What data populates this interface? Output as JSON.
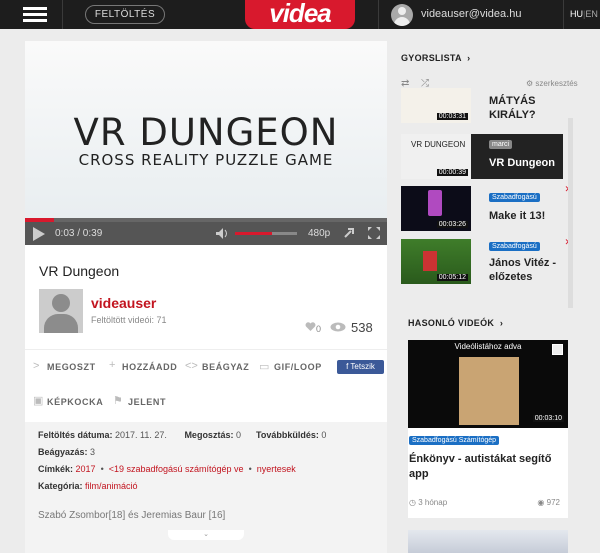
{
  "topbar": {
    "upload_label": "FELTÖLTÉS",
    "logo_text": "videa",
    "user_email": "videauser@videa.hu",
    "lang_active": "HU",
    "lang_other": "EN",
    "brand_color": "#d8192d"
  },
  "player": {
    "title_text": "VR DUNGEON",
    "subtitle_text": "CROSS REALITY PUZZLE GAME",
    "time": "0:03 / 0:39",
    "progress_fraction": 0.08,
    "volume_fraction": 0.6,
    "quality": "480p"
  },
  "video": {
    "name": "VR Dungeon",
    "uploader": "videauser",
    "uploaded_label": "Feltöltött videói:",
    "uploaded_count": "71",
    "likes": "0",
    "views": "538"
  },
  "actions": {
    "share": "MEGOSZT",
    "add": "HOZZÁADD",
    "embed": "BEÁGYAZ",
    "gif": "GIF/LOOP",
    "like": "Tetszik",
    "frame": "KÉPKOCKA",
    "report": "JELENT"
  },
  "details": {
    "upload_date_label": "Feltöltés dátuma:",
    "upload_date": "2017. 11. 27.",
    "shares_label": "Megosztás:",
    "shares": "0",
    "forwards_label": "Továbbküldés:",
    "forwards": "0",
    "embeds_label": "Beágyazás:",
    "embeds": "3",
    "tags_label": "Címkék:",
    "tags": [
      "2017",
      "<19 szabadfogású számítógép ve",
      "nyertesek"
    ],
    "category_label": "Kategória:",
    "category": "film/animáció",
    "authors": "Szabó Zsombor[18] és Jeremias Baur [16]"
  },
  "sidebar": {
    "quicklist_title": "GYORSLISTA",
    "edit_label": "szerkesztés",
    "items": [
      {
        "duration": "00:03:31",
        "title": "MÁTYÁS KIRÁLY?",
        "tag": ""
      },
      {
        "duration": "00:00:39",
        "title": "VR Dungeon",
        "tag": "marci"
      },
      {
        "duration": "00:03:26",
        "title": "Make it 13!",
        "tag": "Szabadfogású"
      },
      {
        "duration": "00:05:12",
        "title": "János Vitéz - előzetes",
        "tag": "Szabadfogású"
      }
    ],
    "related_title": "HASONLÓ VIDEÓK",
    "related": {
      "ad_label": "Videólistához adva",
      "duration": "00:03:10",
      "tag": "Szabadfogású Számítógép",
      "title": "Énkönyv - autistákat segítő app",
      "age": "3 hónap",
      "views": "972"
    }
  }
}
